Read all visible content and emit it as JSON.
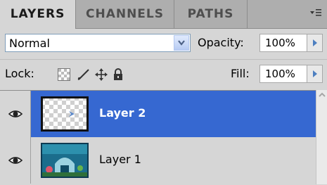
{
  "tabs": [
    {
      "label": "LAYERS"
    },
    {
      "label": "CHANNELS"
    },
    {
      "label": "PATHS"
    }
  ],
  "blend": {
    "mode": "Normal",
    "opacity_label": "Opacity:",
    "opacity_value": "100%"
  },
  "lock": {
    "label": "Lock:",
    "fill_label": "Fill:",
    "fill_value": "100%"
  },
  "layers": [
    {
      "name": "Layer 2",
      "selected": true
    },
    {
      "name": "Layer 1",
      "selected": false
    }
  ],
  "colors": {
    "selection": "#3668d1",
    "arrow_blue": "#4d7fc0"
  },
  "icons": {
    "panel_menu": "panel-menu-icon",
    "lock_transparent": "lock-transparent-pixels-icon",
    "lock_image": "lock-image-pixels-icon",
    "lock_position": "lock-position-icon",
    "lock_all": "lock-all-icon",
    "visibility": "eye-icon"
  }
}
